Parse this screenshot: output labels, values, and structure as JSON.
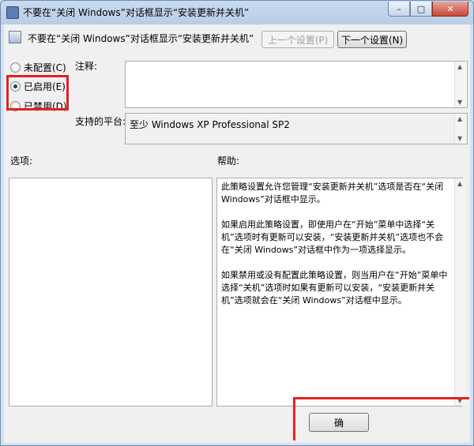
{
  "window": {
    "title": "不要在“关闭 Windows”对话框显示“安装更新并关机”",
    "minimize_icon": "minimize-icon",
    "maximize_icon": "maximize-icon",
    "close_icon": "close-icon"
  },
  "header": {
    "setting_name": "不要在“关闭 Windows”对话框显示“安装更新并关机”",
    "prev_label": "上一个设置(P)",
    "next_label": "下一个设置(N)"
  },
  "state": {
    "not_configured_label": "未配置(C)",
    "enabled_label": "已启用(E)",
    "disabled_label": "已禁用(D)",
    "selected": "enabled"
  },
  "comment": {
    "label": "注释:",
    "value": ""
  },
  "platform": {
    "label": "支持的平台:",
    "value": "至少 Windows XP Professional SP2"
  },
  "options": {
    "label": "选项:"
  },
  "help": {
    "label": "帮助:",
    "paragraphs": [
      "此策略设置允许您管理“安装更新并关机”选项是否在“关闭 Windows”对话框中显示。",
      "如果启用此策略设置，即使用户在“开始”菜单中选择“关机”选项时有更新可以安装，“安装更新并关机”选项也不会在“关闭 Windows”对话框中作为一项选择显示。",
      "如果禁用或没有配置此策略设置，则当用户在“开始”菜单中选择“关机”选项时如果有更新可以安装，“安装更新并关机”选项就会在“关闭 Windows”对话框中显示。"
    ]
  },
  "footer": {
    "ok_label": "确"
  },
  "colors": {
    "highlight": "#e32222",
    "title_bar": "#c9daf0",
    "client_bg": "#f0f0f0"
  }
}
